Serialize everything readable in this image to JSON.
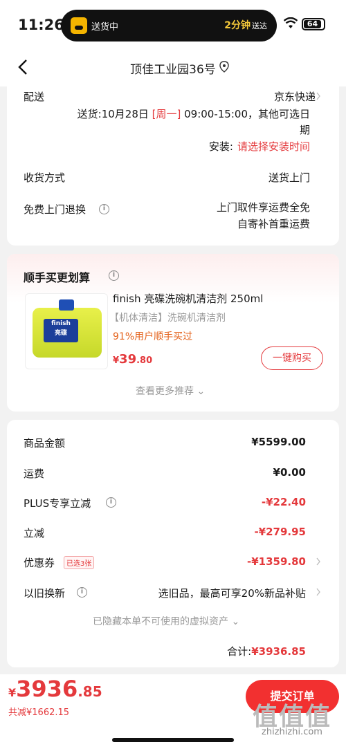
{
  "status_bar": {
    "time": "11:26",
    "island_text": "送货中",
    "island_eta": "2分钟",
    "island_eta_suffix": "送达",
    "battery": "64"
  },
  "nav": {
    "title": "顶佳工业园36号"
  },
  "delivery": {
    "label": "配送",
    "carrier": "京东快递",
    "date_prefix": "送货:10月28日 ",
    "weekday": "[周一]",
    "date_suffix": " 09:00-15:00，其他可选日",
    "date_suffix2": "期",
    "install_label": "安装:",
    "install_value": "请选择安装时间",
    "receive_label": "收货方式",
    "receive_value": "送货上门",
    "return_label": "免费上门退换",
    "return_value_1": "上门取件享运费全免",
    "return_value_2": "自寄补首重运费"
  },
  "recommend": {
    "title": "顺手买更划算",
    "product_name": "finish 亮碟洗碗机清洁剂 250ml",
    "product_tag": "【机体清洁】洗碗机清洁剂",
    "product_note": "91%用户顺手买过",
    "price_cur": "¥",
    "price_int": "39",
    "price_dec": ".80",
    "buy_label": "一键购买",
    "more_label": "查看更多推荐",
    "bottle_label": "finish 亮碟"
  },
  "summary": {
    "rows": [
      {
        "label": "商品金额",
        "value": "¥5599.00"
      },
      {
        "label": "运费",
        "value": "¥0.00"
      },
      {
        "label": "PLUS专享立减",
        "value": "-¥22.40"
      },
      {
        "label": "立减",
        "value": "-¥279.95"
      },
      {
        "label": "优惠券",
        "value": "-¥1359.80",
        "badge": "已选3张"
      },
      {
        "label": "以旧换新",
        "value": "选旧品，最高可享20%新品补贴"
      }
    ],
    "hidden_note": "已隐藏本单不可使用的虚拟资产",
    "total_label": "合计:",
    "total_value": "¥3936.85"
  },
  "bottom": {
    "price_cur": "¥",
    "price_int": "3936",
    "price_dec": ".85",
    "saved": "共减¥1662.15",
    "submit": "提交订单",
    "watermark": "值值值",
    "watermark_url": "zhizhizhi.com"
  },
  "colors": {
    "accent": "#e4393c",
    "orange": "#e4611a"
  }
}
